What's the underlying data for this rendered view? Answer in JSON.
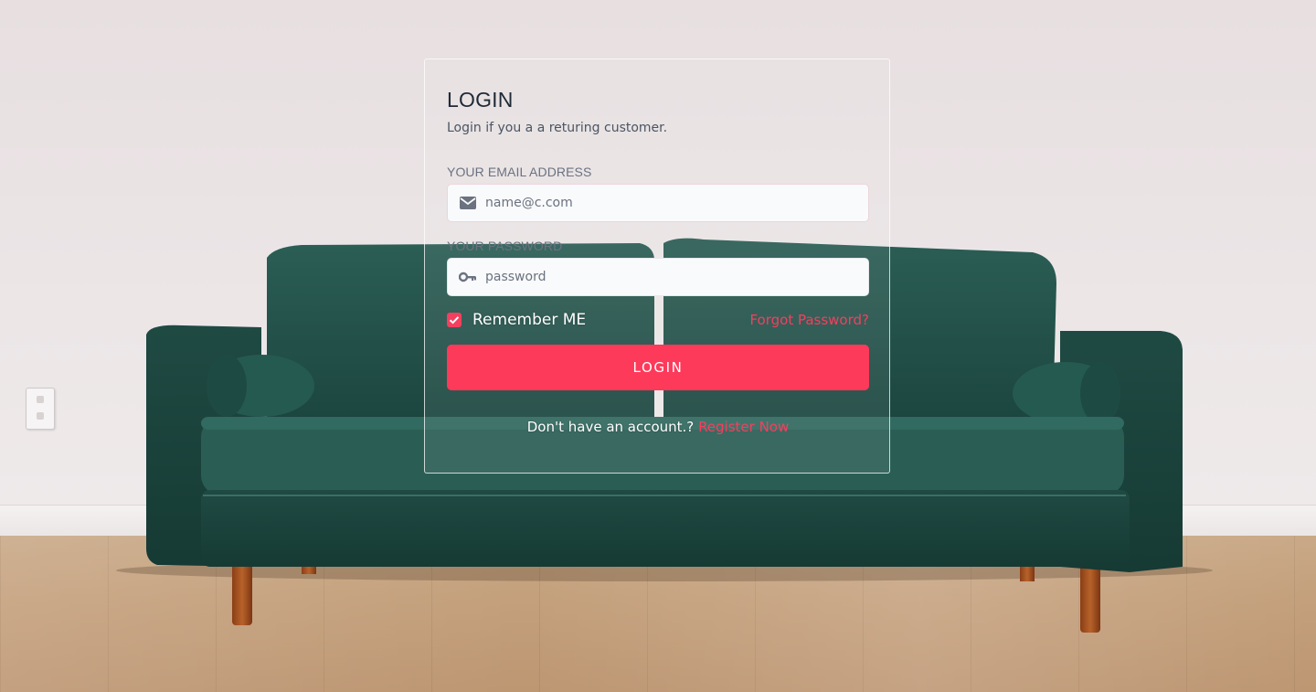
{
  "login": {
    "title": "LOGIN",
    "subtitle": "Login if you a a returing customer.",
    "email": {
      "label": "YOUR EMAIL ADDRESS",
      "placeholder": "name@c.com",
      "value": "",
      "icon": "envelope-icon"
    },
    "password": {
      "label": "YOUR PASSWORD",
      "placeholder": "password",
      "value": "",
      "icon": "key-icon"
    },
    "remember": {
      "label": "Remember ME",
      "checked": true
    },
    "forgot_label": "Forgot Password?",
    "submit_label": "LOGIN",
    "register_prompt": "Don't have an account.?",
    "register_label": "Register Now"
  },
  "colors": {
    "accent": "#fd3a5a",
    "link": "#f43f5e",
    "heading": "#1f2a37",
    "sofa": "#1f4d46",
    "wall": "#ece6e7",
    "floor": "#c4a07c"
  }
}
